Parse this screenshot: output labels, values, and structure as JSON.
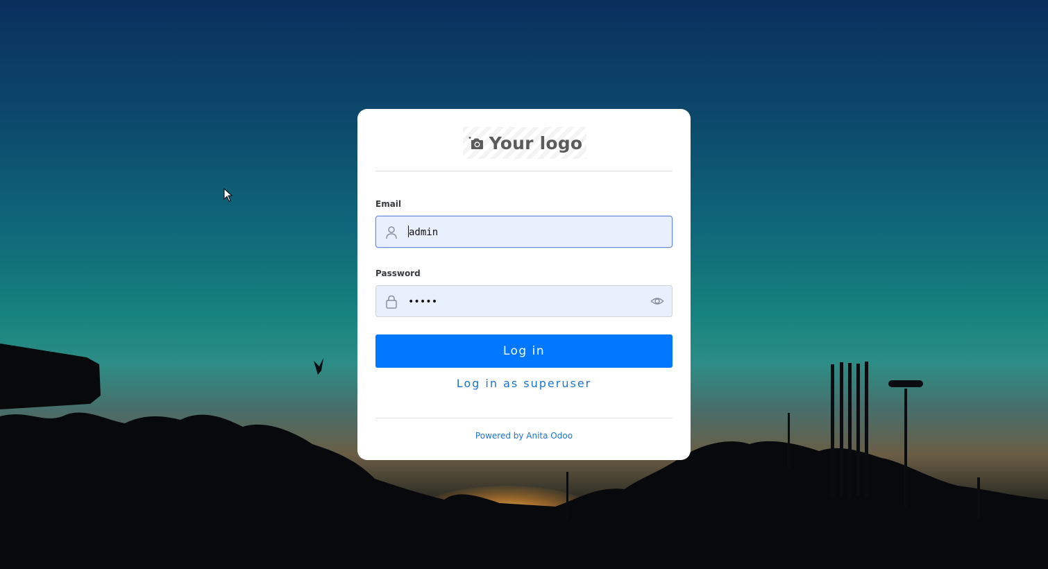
{
  "logo": {
    "text": "Your logo",
    "icon": "camera-plus-icon"
  },
  "form": {
    "email_label": "Email",
    "email_value": "admin",
    "email_icon": "user-icon",
    "password_label": "Password",
    "password_value": "•••••",
    "password_icon": "lock-icon",
    "password_toggle_icon": "eye-icon",
    "login_button": "Log in",
    "superuser_link": "Log in as superuser"
  },
  "footer": {
    "powered_by": "Powered by Anita Odoo"
  },
  "colors": {
    "primary_button": "#0077ff",
    "link": "#1a74d0",
    "input_background": "#e8f0fe"
  }
}
